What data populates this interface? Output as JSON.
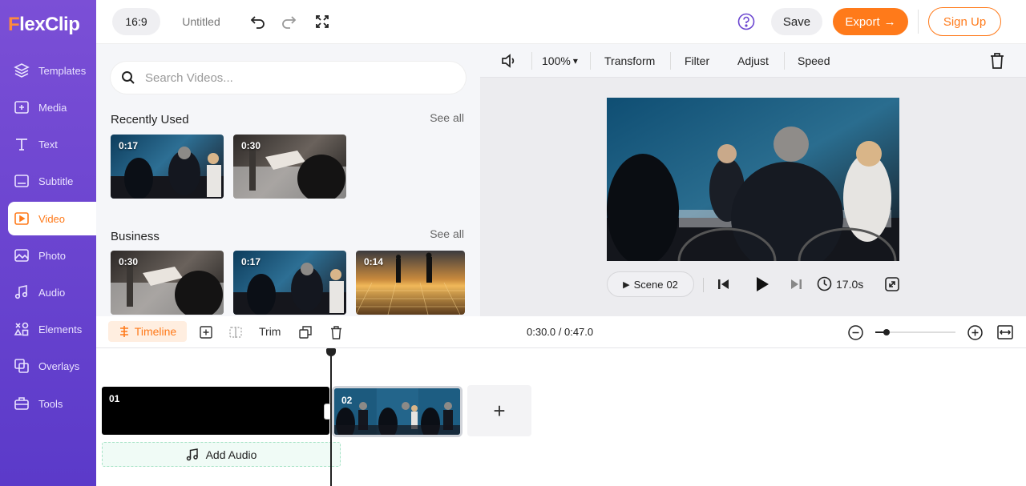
{
  "app": {
    "logo_text": "lexClip",
    "logo_initial": "F",
    "brand_color": "#ff7a1a",
    "sidebar_color": "#6a45d0"
  },
  "sidebar": {
    "items": [
      {
        "label": "Templates",
        "icon": "layers-icon"
      },
      {
        "label": "Media",
        "icon": "media-plus-icon"
      },
      {
        "label": "Text",
        "icon": "text-icon"
      },
      {
        "label": "Subtitle",
        "icon": "subtitle-icon"
      },
      {
        "label": "Video",
        "icon": "video-icon",
        "active": true
      },
      {
        "label": "Photo",
        "icon": "photo-icon"
      },
      {
        "label": "Audio",
        "icon": "audio-icon"
      },
      {
        "label": "Elements",
        "icon": "elements-icon"
      },
      {
        "label": "Overlays",
        "icon": "overlays-icon"
      },
      {
        "label": "Tools",
        "icon": "toolbox-icon"
      }
    ]
  },
  "header": {
    "aspect_ratio": "16:9",
    "project_title": "Untitled",
    "save_label": "Save",
    "export_label": "Export",
    "signup_label": "Sign Up"
  },
  "library": {
    "search_placeholder": "Search Videos...",
    "sections": [
      {
        "title": "Recently Used",
        "see_all": "See all",
        "items": [
          {
            "duration": "0:17"
          },
          {
            "duration": "0:30"
          }
        ]
      },
      {
        "title": "Business",
        "see_all": "See all",
        "items": [
          {
            "duration": "0:30"
          },
          {
            "duration": "0:17"
          },
          {
            "duration": "0:14"
          }
        ]
      }
    ]
  },
  "edit_toolbar": {
    "zoom": "100%",
    "transform_label": "Transform",
    "filter_label": "Filter",
    "adjust_label": "Adjust",
    "speed_label": "Speed"
  },
  "preview": {
    "scene_label": "Scene",
    "scene_number": "02",
    "duration": "17.0s"
  },
  "timeline": {
    "tab_label": "Timeline",
    "trim_label": "Trim",
    "time_display": "0:30.0 / 0:47.0",
    "clips": [
      {
        "number": "01"
      },
      {
        "number": "02"
      }
    ],
    "add_audio_label": "Add Audio",
    "add_clip_symbol": "+"
  }
}
